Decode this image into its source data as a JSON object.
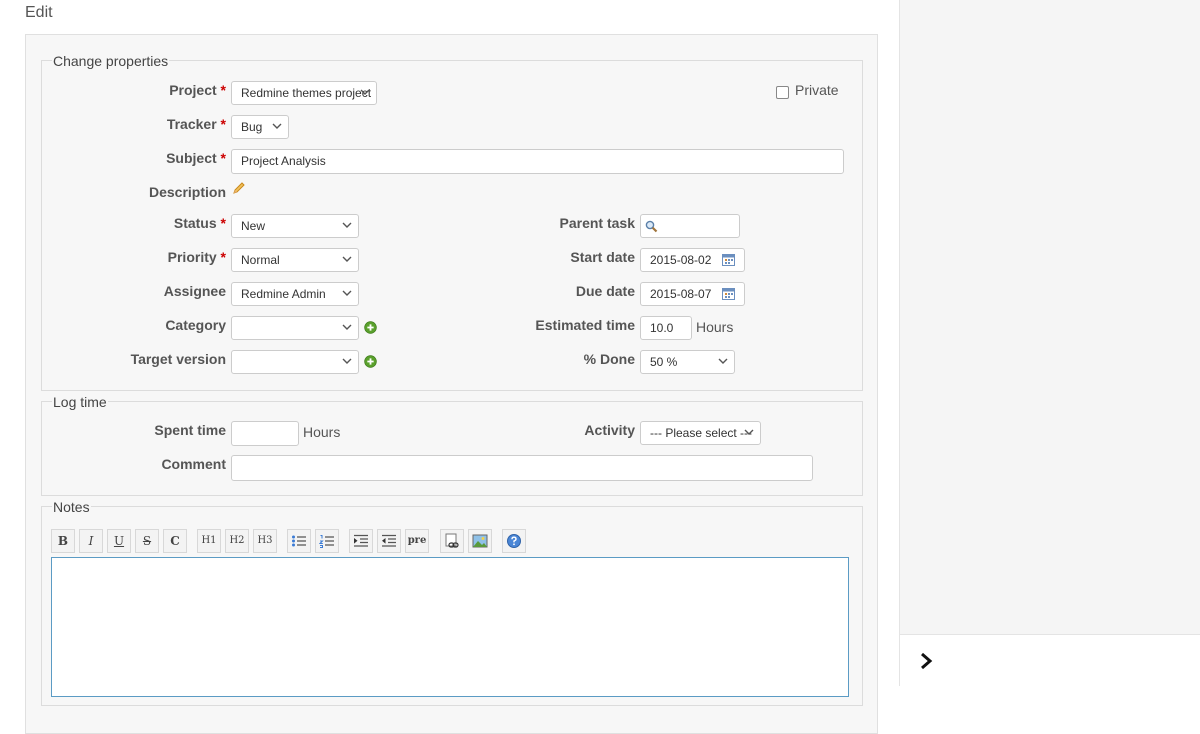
{
  "heading": "Edit",
  "properties": {
    "legend": "Change properties",
    "project": {
      "label": "Project",
      "value": "Redmine themes project"
    },
    "private_label": "Private",
    "tracker": {
      "label": "Tracker",
      "value": "Bug"
    },
    "subject": {
      "label": "Subject",
      "value": "Project Analysis"
    },
    "description_label": "Description",
    "status": {
      "label": "Status",
      "value": "New"
    },
    "priority": {
      "label": "Priority",
      "value": "Normal"
    },
    "assignee": {
      "label": "Assignee",
      "value": "Redmine Admin"
    },
    "category": {
      "label": "Category",
      "value": ""
    },
    "target_version": {
      "label": "Target version",
      "value": ""
    },
    "parent_task": {
      "label": "Parent task",
      "value": ""
    },
    "start_date": {
      "label": "Start date",
      "value": "2015-08-02"
    },
    "due_date": {
      "label": "Due date",
      "value": "2015-08-07"
    },
    "estimated_time": {
      "label": "Estimated time",
      "value": "10.0",
      "unit": "Hours"
    },
    "done": {
      "label": "% Done",
      "value": "50 %"
    }
  },
  "log_time": {
    "legend": "Log time",
    "spent_time": {
      "label": "Spent time",
      "value": "",
      "unit": "Hours"
    },
    "activity": {
      "label": "Activity",
      "value": "--- Please select ---"
    },
    "comment": {
      "label": "Comment",
      "value": ""
    }
  },
  "notes": {
    "legend": "Notes",
    "toolbar": [
      "B",
      "I",
      "U",
      "S",
      "C",
      "H1",
      "H2",
      "H3",
      "ul",
      "ol",
      "indent",
      "outdent",
      "pre",
      "link",
      "image",
      "help"
    ],
    "value": ""
  },
  "colors": {
    "required": "#cc0000",
    "focus_border": "#5b9bc4",
    "add_green": "#5aa02c"
  }
}
